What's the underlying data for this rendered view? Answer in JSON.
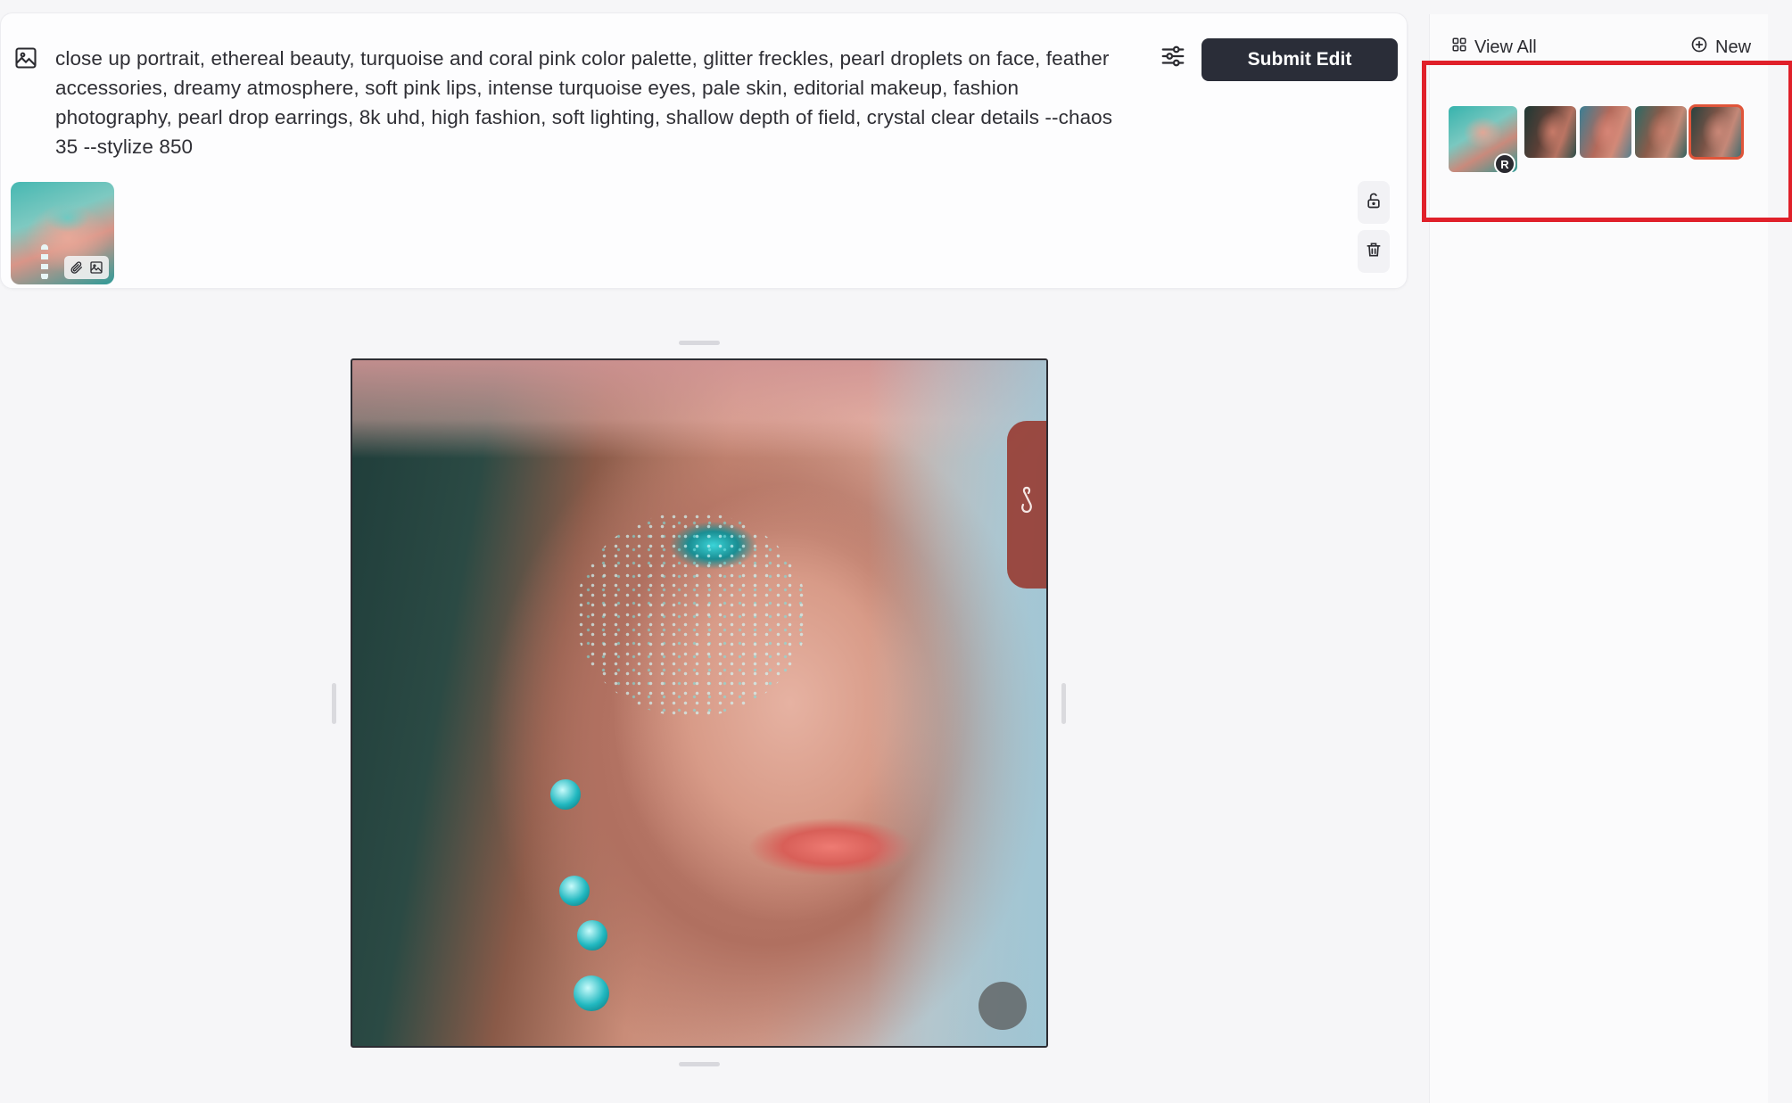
{
  "prompt": {
    "text": "close up portrait, ethereal beauty, turquoise and coral pink color palette, glitter freckles, pearl droplets on face, feather accessories, dreamy atmosphere, soft pink lips, intense turquoise eyes, pale skin, editorial makeup, fashion photography, pearl drop earrings, 8k uhd, high fashion, soft lighting, shallow depth of field, crystal clear details --chaos 35 --stylize 850",
    "submit_label": "Submit Edit"
  },
  "panel": {
    "view_all_label": "View All",
    "new_label": "New",
    "reference_badge": "R"
  },
  "icons": {
    "mode": "image-icon",
    "settings": "sliders-icon",
    "lock": "lock-open-icon",
    "delete": "trash-icon",
    "attach": "paperclip-icon",
    "image_ref": "image-icon"
  },
  "colors": {
    "submit_bg": "#2a2d38",
    "highlight": "#e0202a",
    "selected_variant": "#e0553a"
  }
}
